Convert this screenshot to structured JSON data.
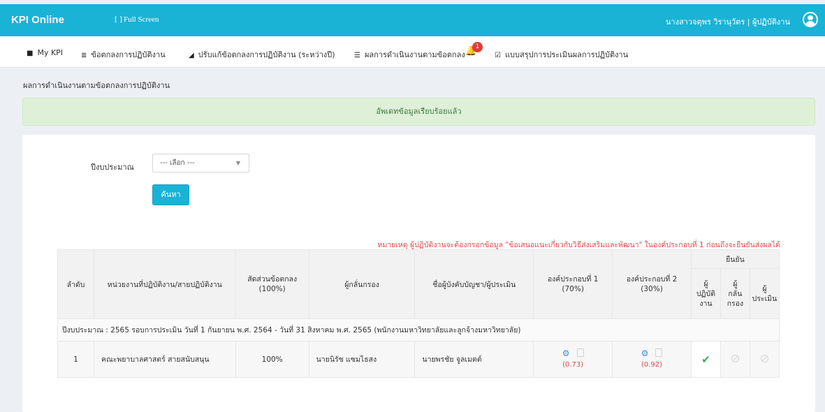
{
  "header": {
    "brand": "KPI Online",
    "fullscreen_icon": "[ ]",
    "fullscreen_label": "Full Screen",
    "user": "นางสาวจตุพร วิรานุวัตร | ผู้ปฏิบัติงาน",
    "user_icon": "user-circle-icon"
  },
  "nav": {
    "items": [
      {
        "icon": "bookmark-icon",
        "glyph": "■",
        "label": "My KPI"
      },
      {
        "icon": "list-icon",
        "glyph": "≣",
        "label": "ข้อตกลงการปฏิบัติงาน"
      },
      {
        "icon": "eraser-icon",
        "glyph": "◢",
        "label": "ปรับแก้ข้อตกลงการปฏิบัติงาน (ระหว่างปี)"
      },
      {
        "icon": "list-ol-icon",
        "glyph": "☰",
        "label": "ผลการดำเนินงานตามข้อตกลง"
      },
      {
        "icon": "check-square-icon",
        "glyph": "☑",
        "label": "แบบสรุปการประเมินผลการปฏิบัติงาน"
      }
    ],
    "notification_count": "1"
  },
  "breadcrumb": "ผลการดำเนินงานตามข้อตกลงการปฏิบัติงาน",
  "alert": "อัพเดทข้อมูลเรียบร้อยแล้ว",
  "filter": {
    "label": "ปีงบประมาณ",
    "select_value": "--- เลือก ---",
    "search_button": "ค้นหา"
  },
  "note": "หมายเหตุ ผู้ปฏิบัติงานจะต้องกรอกข้อมูล \"ข้อเสนอแนะเกี่ยวกับวิธีส่งเสริมและพัฒนา\" ในองค์ประกอบที่ 1 ก่อนถึงจะยืนยันส่งผลได้",
  "table": {
    "headers": {
      "seq": "ลำดับ",
      "unit": "หน่วยงานที่ปฏิบัติงาน/สายปฏิบัติงาน",
      "ratio": [
        "สัดส่วนข้อตกลง",
        "(100%)"
      ],
      "screener": "ผู้กลั่นกรอง",
      "supervisor": "ชื่อผู้บังคับบัญชา/ผู้ประเมิน",
      "comp1": [
        "องค์ประกอบที่ 1",
        "(70%)"
      ],
      "comp2": [
        "องค์ประกอบที่ 2",
        "(30%)"
      ],
      "confirm": "ยืนยัน",
      "confirm_worker": [
        "ผู้",
        "ปฏิบัติ",
        "งาน"
      ],
      "confirm_screener": [
        "ผู้",
        "กลั่น",
        "กรอง"
      ],
      "confirm_evaluator": [
        "ผู้",
        "ประเมิน"
      ]
    },
    "period": "ปีงบประมาณ : 2565 รอบการประเมิน วันที่ 1 กันยายน พ.ศ. 2564 - วันที่ 31 สิงหาคม พ.ศ. 2565 (พนักงานมหาวิทยาลัยและลูกจ้างมหาวิทยาลัย)",
    "rows": [
      {
        "seq": "1",
        "unit": "คณะพยาบาลศาสตร์ สายสนับสนุน",
        "ratio": "100%",
        "screener": "นายนิรัช แซมไธสง",
        "supervisor": "นายพรชัย จูลเมตต์",
        "comp1_score": "(0.73)",
        "comp2_score": "(0.92)",
        "worker_confirmed": "✔",
        "colors": {
          "check": "#2fb34a",
          "score": "#e04848"
        }
      }
    ]
  }
}
